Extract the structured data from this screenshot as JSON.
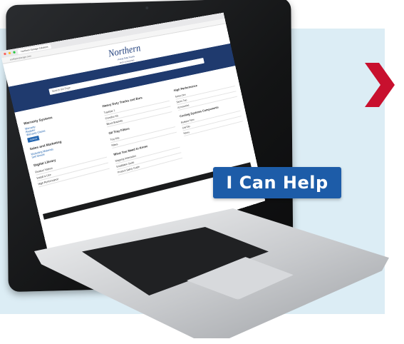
{
  "colors": {
    "accent": "#1d5ca8",
    "chevron": "#c8102e",
    "panel": "#dcedf5",
    "navy": "#1f3a6e"
  },
  "badge": {
    "label": "I Can Help"
  },
  "screen": {
    "tab_title": "Northern Storage Solutions",
    "url": "northernstorage.com",
    "logo": "Northern",
    "tagline": "Heavy Duty Tracks",
    "tagline2": "and Accessories",
    "search_placeholder": "Search the Page",
    "sections": [
      {
        "title": "Warranty Systems",
        "links": [
          "Warranty",
          "Register",
          "Warranty Claims"
        ],
        "button": "Submit"
      },
      {
        "title": "Sales and Marketing",
        "links": [
          "Marketing Materials",
          "Sell Sheets"
        ]
      },
      {
        "title": "Digital Library",
        "items": [
          "Product Videos",
          "Install & Use",
          "High Performance"
        ]
      }
    ],
    "col2": [
      {
        "title": "Heavy Duty Tracks and Bars",
        "items": [
          "Trackbar 1",
          "Crossbar Kit",
          "Mount Brackets"
        ]
      },
      {
        "title": "Oil Tray Filters",
        "items": [
          "Tray Kits",
          "Filters"
        ]
      },
      {
        "title": "What You Need to Know",
        "items": [
          "Shipping Information",
          "Installation Guide",
          "Product Safety Guide"
        ]
      }
    ],
    "col3": [
      {
        "title": "High Performance",
        "items": [
          "Series One",
          "Series Two",
          "Accessories"
        ]
      },
      {
        "title": "Cooling Systems Components",
        "items": [
          "Radiator Fans",
          "Coil Kits",
          "Hoses"
        ]
      }
    ]
  }
}
